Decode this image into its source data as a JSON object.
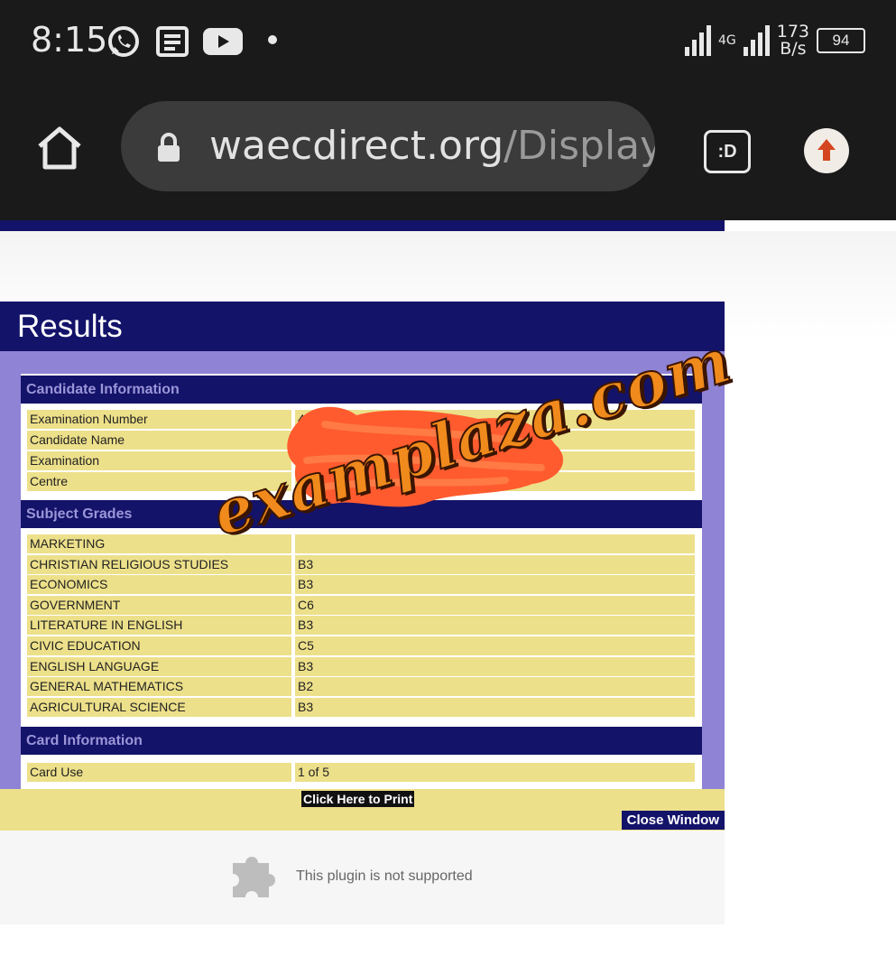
{
  "status_bar": {
    "time": "8:15",
    "network_type": "4G",
    "speed_value": "173",
    "speed_unit": "B/s",
    "battery": "94",
    "icons": [
      "whatsapp-icon",
      "news-icon",
      "youtube-icon",
      "dot-icon",
      "signal-icon",
      "battery-icon"
    ]
  },
  "browser": {
    "url_domain": "waecdirect.org",
    "url_path": "/DisplayR",
    "tab_label": ":D",
    "icons": [
      "home-icon",
      "lock-icon",
      "tab-switcher-icon",
      "update-icon"
    ]
  },
  "page": {
    "title": "Results",
    "candidate_section": "Candidate Information",
    "candidate_rows": [
      {
        "label": "Examination Number",
        "value": "4"
      },
      {
        "label": "Candidate Name",
        "value": ""
      },
      {
        "label": "Examination",
        "value": ""
      },
      {
        "label": "Centre",
        "value": ""
      }
    ],
    "grades_section": "Subject Grades",
    "grades": [
      {
        "subject": "MARKETING",
        "grade": ""
      },
      {
        "subject": "CHRISTIAN RELIGIOUS STUDIES",
        "grade": "B3"
      },
      {
        "subject": "ECONOMICS",
        "grade": "B3"
      },
      {
        "subject": "GOVERNMENT",
        "grade": "C6"
      },
      {
        "subject": "LITERATURE IN ENGLISH",
        "grade": "B3"
      },
      {
        "subject": "CIVIC EDUCATION",
        "grade": "C5"
      },
      {
        "subject": "ENGLISH LANGUAGE",
        "grade": "B3"
      },
      {
        "subject": "GENERAL MATHEMATICS",
        "grade": "B2"
      },
      {
        "subject": "AGRICULTURAL SCIENCE",
        "grade": "B3"
      }
    ],
    "card_section": "Card Information",
    "card_rows": [
      {
        "label": "Card Use",
        "value": "1 of 5"
      }
    ],
    "print_label": "Click Here to Print",
    "close_label": "Close Window",
    "plugin_message": "This plugin is not supported"
  },
  "overlay": {
    "watermark": "examplaza.com"
  },
  "colors": {
    "navy": "#14136a",
    "lavender": "#8f83d6",
    "row_yellow": "#ede08a",
    "redaction_orange": "#ff5b2e",
    "watermark_orange": "#f08a1c"
  }
}
